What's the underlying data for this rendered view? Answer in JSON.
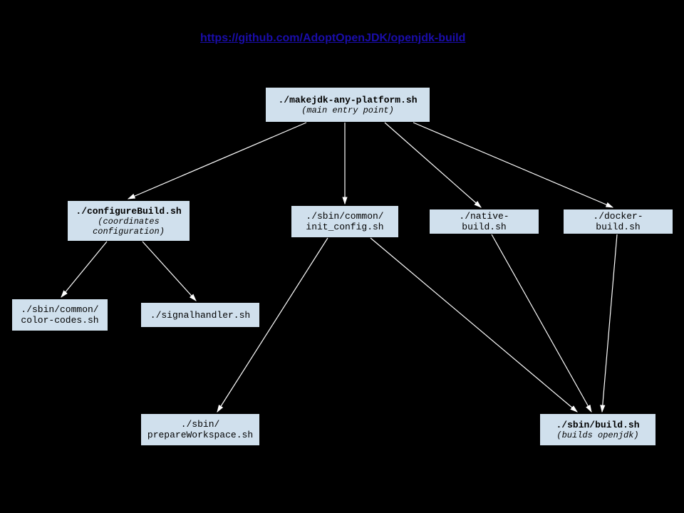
{
  "header": {
    "link_text": "https://github.com/AdoptOpenJDK/openjdk-build",
    "link_href": "https://github.com/AdoptOpenJDK/openjdk-build"
  },
  "boxes": {
    "main": {
      "title": "./makejdk-any-platform.sh",
      "subtitle": "(main entry point)"
    },
    "configure": {
      "title": "./configureBuild.sh",
      "subtitle": "(coordinates configuration)"
    },
    "init_config": {
      "line1": "./sbin/common/",
      "line2": "init_config.sh"
    },
    "native_build": {
      "title": "./native-build.sh"
    },
    "docker_build": {
      "title": "./docker-build.sh"
    },
    "color_codes": {
      "line1": "./sbin/common/",
      "line2": "color-codes.sh"
    },
    "signalhandler": {
      "title": "./signalhandler.sh"
    },
    "prepare_workspace": {
      "line1": "./sbin/",
      "line2": "prepareWorkspace.sh"
    },
    "build": {
      "title": "./sbin/build.sh",
      "subtitle": "(builds openjdk)"
    }
  }
}
